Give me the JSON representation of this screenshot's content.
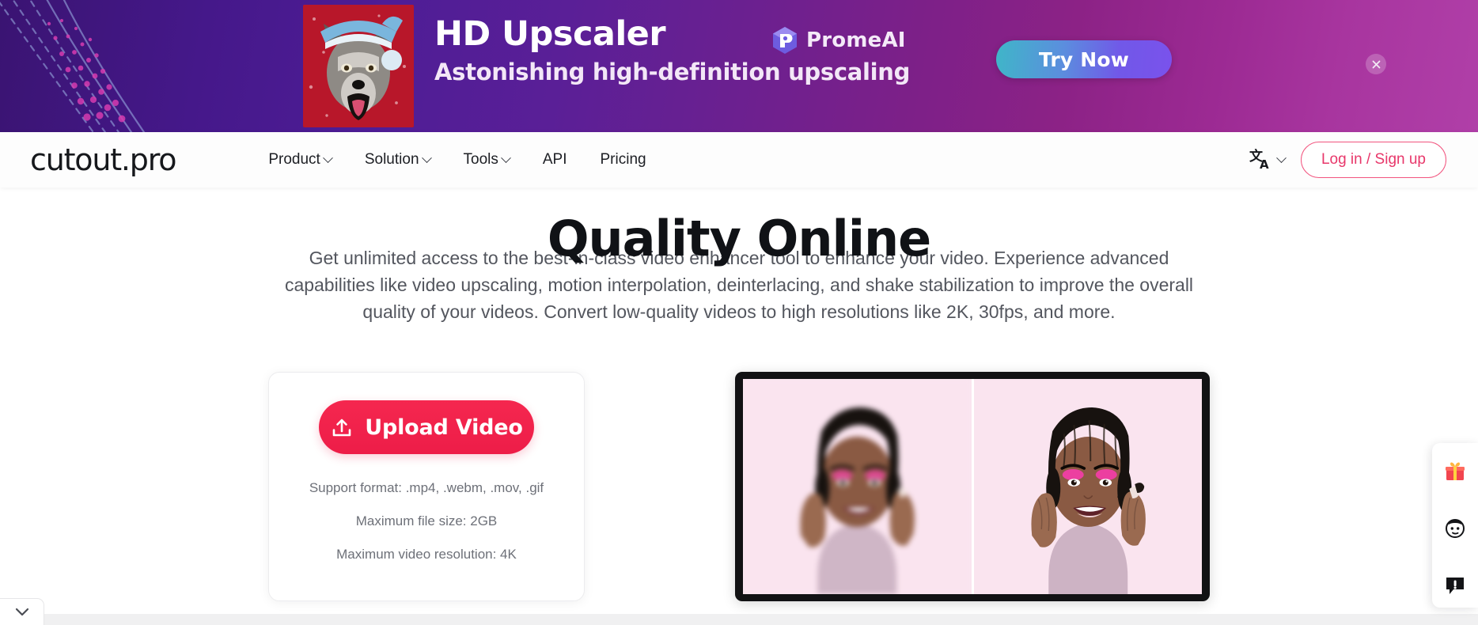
{
  "promo_banner": {
    "title": "HD Upscaler",
    "subtitle": "Astonishing high-definition upscaling",
    "partner_brand": "PromeAI",
    "cta_label": "Try Now",
    "close_label": "×",
    "colors": {
      "gradient_start": "#3a1472",
      "gradient_end": "#b03fa8",
      "cta_gradient_start": "#3fb6c8",
      "cta_gradient_end": "#7a52ec"
    }
  },
  "navbar": {
    "logo": "cutout.pro",
    "links": [
      {
        "label": "Product",
        "has_dropdown": true
      },
      {
        "label": "Solution",
        "has_dropdown": true
      },
      {
        "label": "Tools",
        "has_dropdown": true
      },
      {
        "label": "API",
        "has_dropdown": false
      },
      {
        "label": "Pricing",
        "has_dropdown": false
      }
    ],
    "language_icon": "translate-icon",
    "login_label": "Log in / Sign up",
    "accent_color": "#e8376a"
  },
  "hero": {
    "title": "Quality Online",
    "description": "Get unlimited access to the best-in-class video enhancer tool to enhance your video. Experience advanced capabilities like video upscaling, motion interpolation, deinterlacing, and shake stabilization to improve the overall quality of your videos. Convert low-quality videos to high resolutions like 2K, 30fps, and more."
  },
  "upload_card": {
    "button_label": "Upload Video",
    "button_icon": "upload-icon",
    "notes": [
      "Support format: .mp4, .webm, .mov, .gif",
      "Maximum file size: 2GB",
      "Maximum video resolution: 4K"
    ],
    "button_color": "#ed1d48"
  },
  "video_preview": {
    "alt": "Before and after video enhancement comparison",
    "panes": [
      {
        "name": "before",
        "state": "low-quality blurry"
      },
      {
        "name": "after",
        "state": "enhanced sharp"
      }
    ]
  },
  "side_widget": {
    "items": [
      {
        "icon": "gift-icon",
        "label": "Gift"
      },
      {
        "icon": "support-face-icon",
        "label": "Support"
      },
      {
        "icon": "feedback-icon",
        "label": "Feedback"
      }
    ]
  },
  "collapse_tab": {
    "icon": "chevron-down-icon"
  }
}
